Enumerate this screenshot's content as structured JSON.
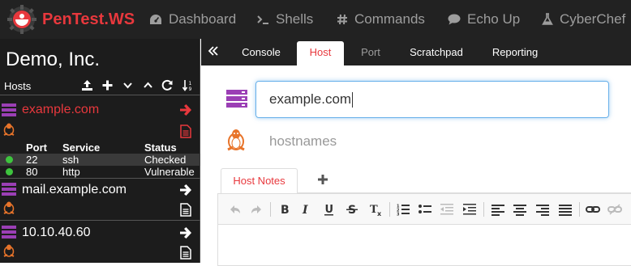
{
  "app": {
    "brand": "PenTest.WS",
    "brand_color": "#e8383d"
  },
  "nav": [
    {
      "label": "Dashboard",
      "icon": "dashboard-icon"
    },
    {
      "label": "Shells",
      "icon": "terminal-icon"
    },
    {
      "label": "Commands",
      "icon": "hashtag-icon"
    },
    {
      "label": "Echo Up",
      "icon": "comment-icon"
    },
    {
      "label": "CyberChef",
      "icon": "flask-icon"
    }
  ],
  "sidebar": {
    "company": "Demo, Inc.",
    "hosts_label": "Hosts",
    "hosts": [
      {
        "name": "example.com",
        "selected": true,
        "os": "linux"
      },
      {
        "name": "mail.example.com",
        "selected": false,
        "os": "linux"
      },
      {
        "name": "10.10.40.60",
        "selected": false,
        "os": "linux"
      }
    ],
    "ports_table": {
      "headers": [
        "Port",
        "Service",
        "Status"
      ],
      "rows": [
        {
          "port": "22",
          "service": "ssh",
          "status": "Checked",
          "indicator": "#3ec43e"
        },
        {
          "port": "80",
          "service": "http",
          "status": "Vulnerable",
          "indicator": "#3ec43e"
        }
      ]
    }
  },
  "tabs": [
    {
      "label": "Console",
      "active": false
    },
    {
      "label": "Host",
      "active": true
    },
    {
      "label": "Port",
      "active": false
    },
    {
      "label": "Scratchpad",
      "active": false
    },
    {
      "label": "Reporting",
      "active": false
    }
  ],
  "host_form": {
    "host_value": "example.com",
    "hostnames_placeholder": "hostnames"
  },
  "notes": {
    "tab_label": "Host Notes",
    "add_label": "+"
  },
  "editor_toolbar": [
    "undo",
    "redo",
    "bold",
    "italic",
    "underline",
    "strikethrough",
    "clear-format",
    "ordered-list",
    "bullet-list",
    "outdent",
    "indent",
    "align-left",
    "align-center",
    "align-right",
    "align-justify",
    "link",
    "unlink"
  ],
  "colors": {
    "accent_red": "#e8383d",
    "server_purple": "#9b3fb5",
    "tux_orange": "#e8742a"
  }
}
